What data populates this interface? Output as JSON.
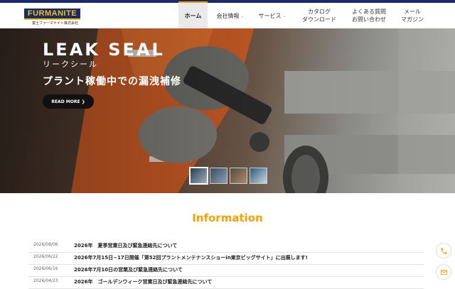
{
  "logo": {
    "word": "FURMANITE",
    "sub": "富士ファーマナイト株式会社"
  },
  "nav": [
    {
      "label": "ホーム",
      "caret": false
    },
    {
      "label": "会社情報",
      "caret": true
    },
    {
      "label": "サービス",
      "caret": true
    },
    {
      "label": "カタログ\nダウンロード",
      "caret": false
    },
    {
      "label": "よくある質問\nお問い合わせ",
      "caret": false
    },
    {
      "label": "メール\nマガジン",
      "caret": false
    }
  ],
  "hero": {
    "title": "LEAK SEAL",
    "kana": "リークシール",
    "subtitle": "プラント稼働中での漏洩補修",
    "button": "READ MORE ❯",
    "thumb_count": 4
  },
  "info": {
    "title": "Information",
    "items": [
      {
        "date": "2026/08/06",
        "text": "2026年　夏季営業日及び緊急連絡先について"
      },
      {
        "date": "2026/06/22",
        "text": "2026年7月15日~17日開催「第52回プラントメンテナンスショーin東京ビッグサイト」に出展します!"
      },
      {
        "date": "2026/06/16",
        "text": "2026年7月10日の営業及び緊急連絡先について"
      },
      {
        "date": "2026/04/23",
        "text": "2026年　ゴールデンウィーク営業日及び緊急連絡先について"
      }
    ]
  },
  "colors": {
    "navy": "#1b2a6b",
    "gold": "#f5c100",
    "accent": "#f5a000"
  },
  "icons": {
    "phone": "phone-icon",
    "mail": "mail-icon"
  }
}
